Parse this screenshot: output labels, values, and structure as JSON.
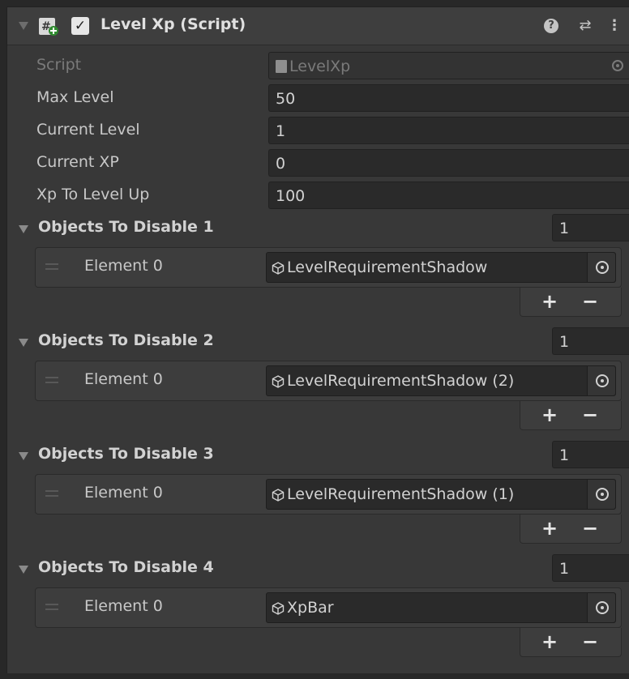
{
  "component": {
    "title": "Level Xp (Script)",
    "enabled_check": "✓",
    "header_icons": [
      "help-icon",
      "presets-icon",
      "context-menu-icon"
    ]
  },
  "fields": [
    {
      "label": "Script",
      "value": "LevelXp"
    },
    {
      "label": "Max Level",
      "value": "50"
    },
    {
      "label": "Current Level",
      "value": "1"
    },
    {
      "label": "Current XP",
      "value": "0"
    },
    {
      "label": "Xp To Level Up",
      "value": "100"
    }
  ],
  "lists": [
    {
      "title": "Objects To Disable 1",
      "size": "1",
      "element_label": "Element 0",
      "element_value": "LevelRequirementShadow"
    },
    {
      "title": "Objects To Disable 2",
      "size": "1",
      "element_label": "Element 0",
      "element_value": "LevelRequirementShadow (2)"
    },
    {
      "title": "Objects To Disable 3",
      "size": "1",
      "element_label": "Element 0",
      "element_value": "LevelRequirementShadow (1)"
    },
    {
      "title": "Objects To Disable 4",
      "size": "1",
      "element_label": "Element 0",
      "element_value": "XpBar"
    }
  ],
  "list_buttons": {
    "add": "+",
    "remove": "−"
  },
  "colors": {
    "panel": "#383838",
    "field": "#2a2a2a",
    "text": "#c8c8c8"
  }
}
